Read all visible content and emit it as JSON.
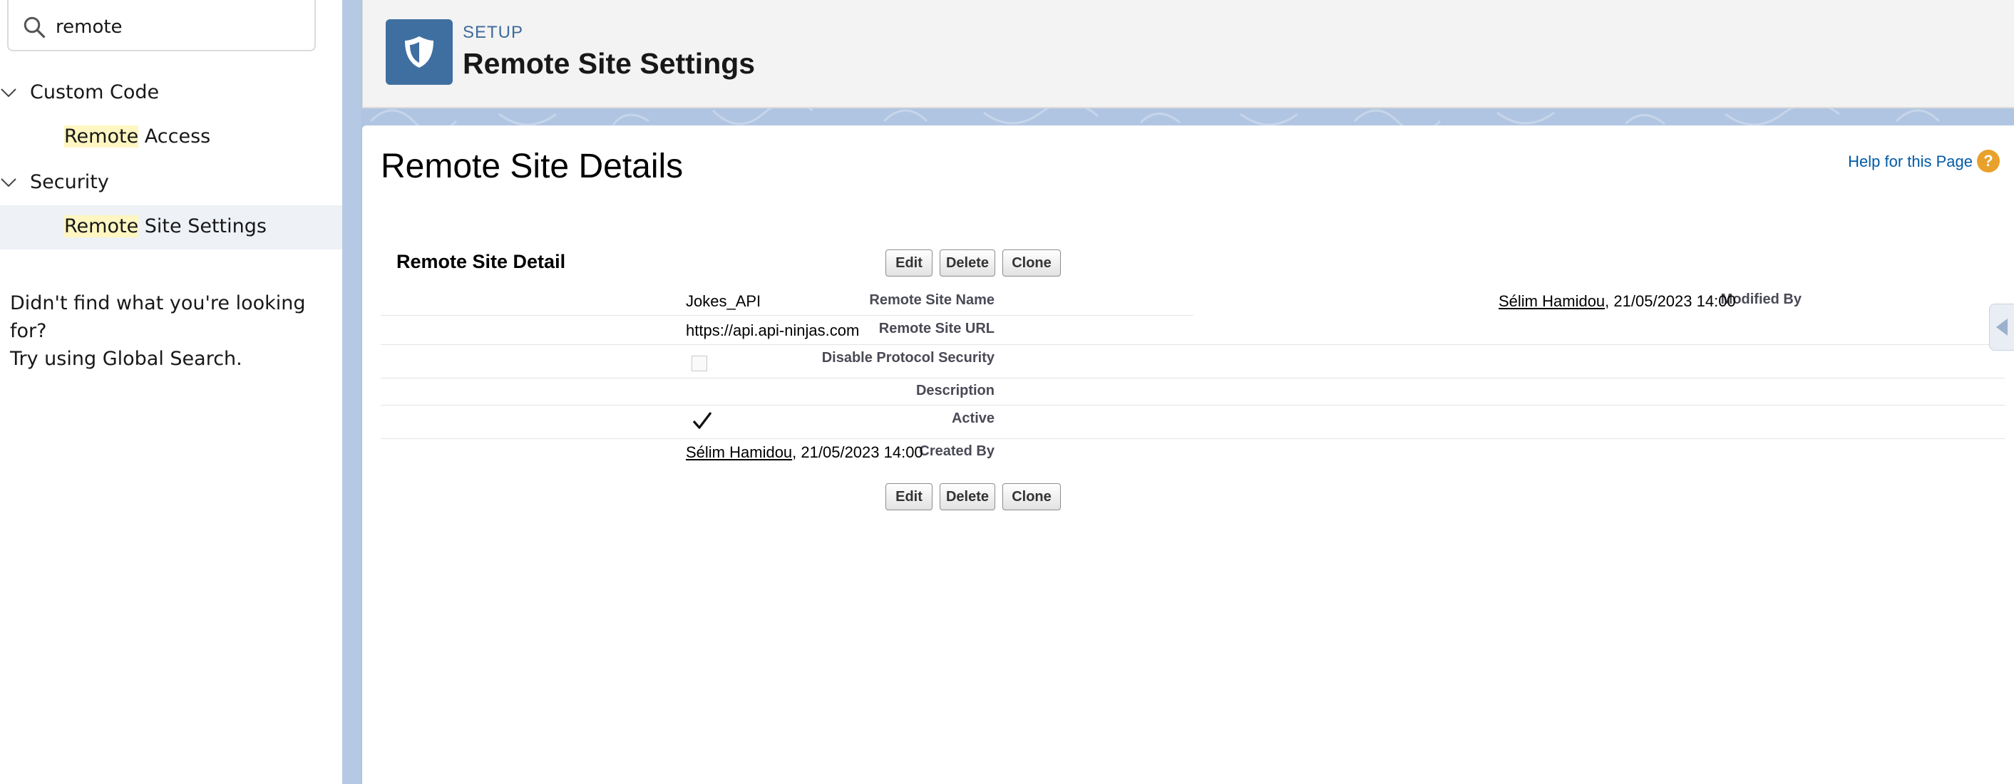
{
  "search": {
    "value": "remote"
  },
  "sidebar": {
    "groups": [
      {
        "label": "Custom Code",
        "items": [
          {
            "highlight": "Remote",
            "rest": " Access"
          }
        ]
      },
      {
        "label": "Security",
        "items": [
          {
            "highlight": "Remote",
            "rest": " Site Settings"
          }
        ]
      }
    ],
    "help_line1": "Didn't find what you're looking for?",
    "help_line2": "Try using Global Search."
  },
  "header": {
    "eyebrow": "SETUP",
    "title": "Remote Site Settings",
    "icon": "shield-icon"
  },
  "page": {
    "title": "Remote Site Details",
    "help_link": "Help for this Page",
    "help_icon": "?"
  },
  "detail": {
    "section_title": "Remote Site Detail",
    "buttons": {
      "edit": "Edit",
      "delete": "Delete",
      "clone": "Clone"
    },
    "fields": {
      "name_label": "Remote Site Name",
      "name_value": "Jokes_API",
      "url_label": "Remote Site URL",
      "url_value": "https://api.api-ninjas.com",
      "disable_label": "Disable Protocol Security",
      "disable_value": false,
      "description_label": "Description",
      "description_value": "",
      "active_label": "Active",
      "active_value": true,
      "created_label": "Created By",
      "created_user": "Sélim Hamidou",
      "created_date": ", 21/05/2023 14:00",
      "modified_label": "Modified By",
      "modified_user": "Sélim Hamidou",
      "modified_date": ", 21/05/2023 14:00"
    }
  },
  "colors": {
    "brand_icon_bg": "#3f6fa0",
    "link": "#015ba7",
    "highlight": "#fff6c1",
    "selected_row": "#eef1f6"
  }
}
